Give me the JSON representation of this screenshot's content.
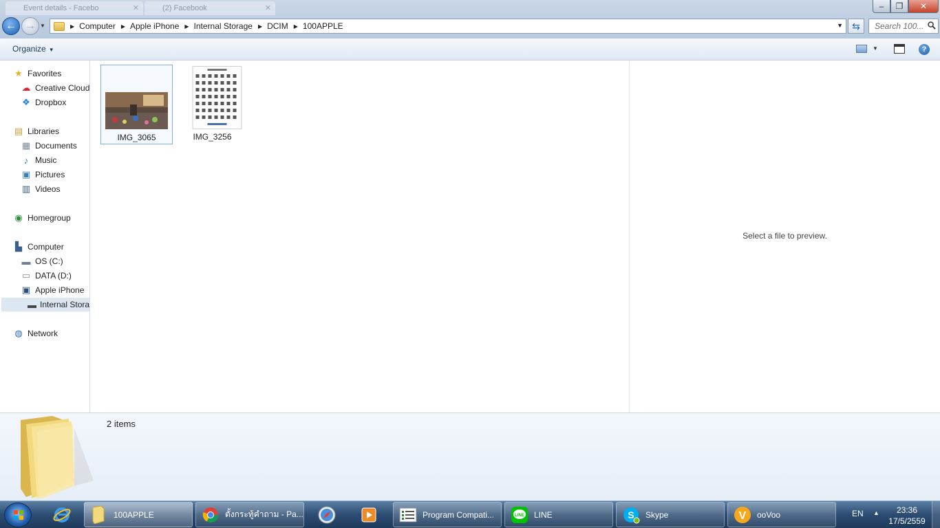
{
  "browser_tabs": [
    {
      "label": "Event details - Facebo"
    },
    {
      "label": "(2) Facebook"
    }
  ],
  "window_controls": {
    "minimize": "–",
    "maximize": "❐",
    "close": "✕"
  },
  "address": {
    "crumbs": [
      "Computer",
      "Apple iPhone",
      "Internal Storage",
      "DCIM",
      "100APPLE"
    ]
  },
  "search": {
    "placeholder": "Search 100..."
  },
  "toolbar": {
    "organize_label": "Organize"
  },
  "nav": {
    "favorites": "Favorites",
    "creative_cloud": "Creative Cloud",
    "dropbox": "Dropbox",
    "libraries": "Libraries",
    "documents": "Documents",
    "music": "Music",
    "pictures": "Pictures",
    "videos": "Videos",
    "homegroup": "Homegroup",
    "computer": "Computer",
    "os_c": "OS (C:)",
    "data_d": "DATA (D:)",
    "apple_iphone": "Apple iPhone",
    "internal_storage": "Internal Storage",
    "network": "Network"
  },
  "files": [
    {
      "name": "IMG_3065",
      "selected": true
    },
    {
      "name": "IMG_3256",
      "selected": false
    }
  ],
  "preview": {
    "message": "Select a file to preview."
  },
  "details": {
    "item_count": "2 items"
  },
  "taskbar": {
    "items": [
      {
        "label": "100APPLE"
      },
      {
        "label": "ตั้งกระทู้คำถาม - Pa..."
      },
      {
        "label": "Program Compati..."
      },
      {
        "label": "LINE"
      },
      {
        "label": "Skype"
      },
      {
        "label": "ooVoo"
      }
    ],
    "language": "EN",
    "time": "23:36",
    "date": "17/5/2559"
  },
  "colors": {
    "accent": "#1b5fb6",
    "selection_border": "#84acdd",
    "taskbar": "#2c4c72"
  }
}
